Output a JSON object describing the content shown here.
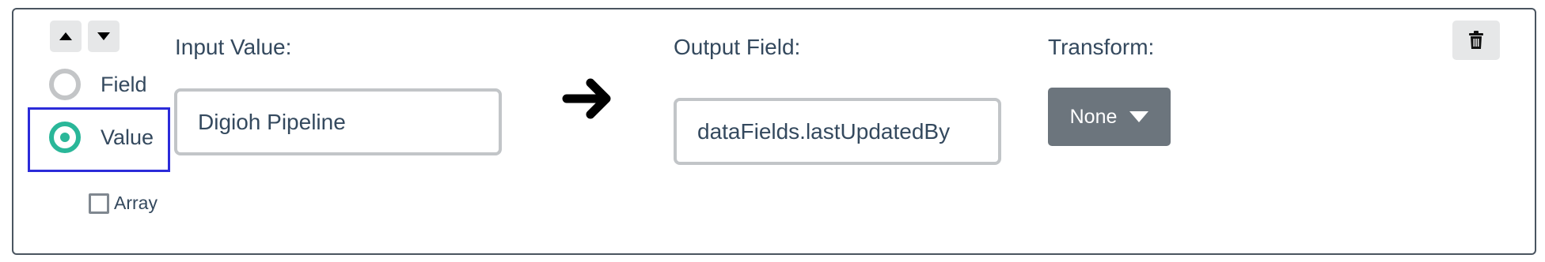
{
  "mapping_row": {
    "move_up_icon": "caret-up-icon",
    "move_down_icon": "caret-down-icon",
    "source_type": {
      "options": [
        {
          "label": "Field",
          "checked": false
        },
        {
          "label": "Value",
          "checked": true
        }
      ]
    },
    "array": {
      "label": "Array",
      "checked": false
    },
    "input_value": {
      "label": "Input Value:",
      "value": "Digioh Pipeline"
    },
    "arrow_icon": "arrow-right-icon",
    "output_field": {
      "label": "Output Field:",
      "value": "dataFields.lastUpdatedBy"
    },
    "transform": {
      "label": "Transform:",
      "selected": "None",
      "caret_icon": "caret-down-icon"
    },
    "delete_icon": "trash-icon"
  },
  "colors": {
    "radio_checked": "#2ab799",
    "radio_unchecked": "#c3c5c7",
    "focus_outline": "#2b2bd9",
    "text": "#34495e",
    "transform_button": "#6c757d",
    "icon_button_bg": "#e6e7e8",
    "card_border": "#4a5560",
    "input_border": "#c2c5c8"
  }
}
